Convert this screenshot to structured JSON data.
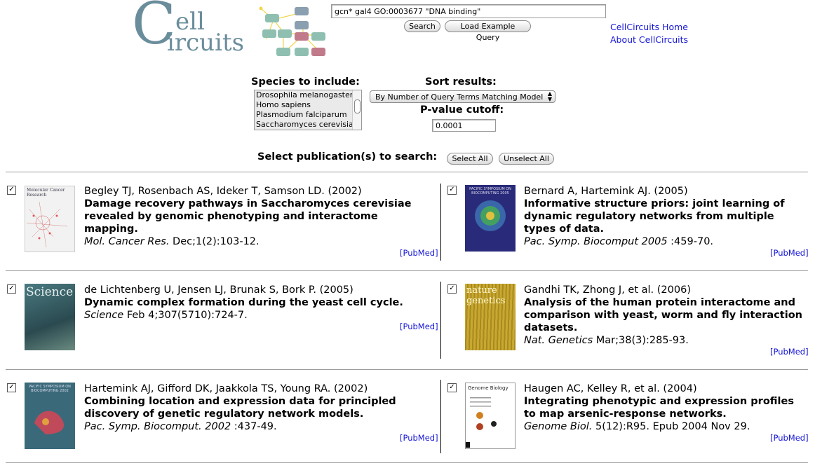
{
  "logo": {
    "c": "C",
    "ell": "ell",
    "ircuits": "ircuits"
  },
  "search": {
    "query": "gcn* gal4 GO:0003677 \"DNA binding\"",
    "search_label": "Search",
    "example_label": "Load Example Query"
  },
  "links": {
    "home": "CellCircuits Home",
    "about": "About CellCircuits"
  },
  "options": {
    "species_heading": "Species to include:",
    "species": [
      "Drosophila melanogaster",
      "Homo sapiens",
      "Plasmodium falciparum",
      "Saccharomyces cerevisiae"
    ],
    "sort_heading": "Sort results:",
    "sort_value": "By Number of Query Terms Matching Model",
    "pvalue_heading": "P-value cutoff:",
    "pvalue": "0.0001"
  },
  "publications_bar": {
    "label": "Select publication(s) to search:",
    "select_all": "Select All",
    "unselect_all": "Unselect All"
  },
  "publications": [
    {
      "checked": true,
      "authors": "Begley TJ, Rosenbach AS, Ideker T, Samson LD. (2002)",
      "title": "Damage recovery pathways in Saccharomyces cerevisiae revealed by genomic phenotyping and interactome mapping.",
      "journal": "Mol. Cancer Res.",
      "citation": " Dec;1(2):103-12.",
      "pubmed": "[PubMed]",
      "cover_text": "Molecular Cancer Research"
    },
    {
      "checked": true,
      "authors": "Bernard A, Hartemink AJ. (2005)",
      "title": "Informative structure priors: joint learning of dynamic regulatory networks from multiple types of data.",
      "journal": "Pac. Symp. Biocomput 2005",
      "citation": " :459-70.",
      "pubmed": "[PubMed]",
      "cover_text": "PACIFIC SYMPOSIUM ON BIOCOMPUTING 2005"
    },
    {
      "checked": true,
      "authors": "de Lichtenberg U, Jensen LJ, Brunak S, Bork P. (2005)",
      "title": "Dynamic complex formation during the yeast cell cycle.",
      "journal": "Science",
      "citation": " Feb 4;307(5710):724-7.",
      "pubmed": "[PubMed]",
      "cover_text": "Science"
    },
    {
      "checked": true,
      "authors": "Gandhi TK, Zhong J, et al. (2006)",
      "title": "Analysis of the human protein interactome and comparison with yeast, worm and fly interaction datasets.",
      "journal": "Nat. Genetics",
      "citation": " Mar;38(3):285-93.",
      "pubmed": "[PubMed]",
      "cover_text": "nature genetics"
    },
    {
      "checked": true,
      "authors": "Hartemink AJ, Gifford DK, Jaakkola TS, Young RA. (2002)",
      "title": "Combining location and expression data for principled discovery of genetic regulatory network models.",
      "journal": "Pac. Symp. Biocomput. 2002",
      "citation": " :437-49.",
      "pubmed": "[PubMed]",
      "cover_text": "PACIFIC SYMPOSIUM ON BIOCOMPUTING 2002"
    },
    {
      "checked": true,
      "authors": "Haugen AC, Kelley R, et al. (2004)",
      "title": "Integrating phenotypic and expression profiles to map arsenic-response networks.",
      "journal": "Genome Biol.",
      "citation": " 5(12):R95. Epub 2004 Nov 29.",
      "pubmed": "[PubMed]",
      "cover_text": "Genome Biology"
    }
  ],
  "colors": {
    "logo": "#6a8d9c",
    "link": "#1515d6",
    "node_teal": "#8fbfb0",
    "node_slate": "#8a9fb0",
    "node_rose": "#c07a8a",
    "edge": "#f2d64a"
  }
}
